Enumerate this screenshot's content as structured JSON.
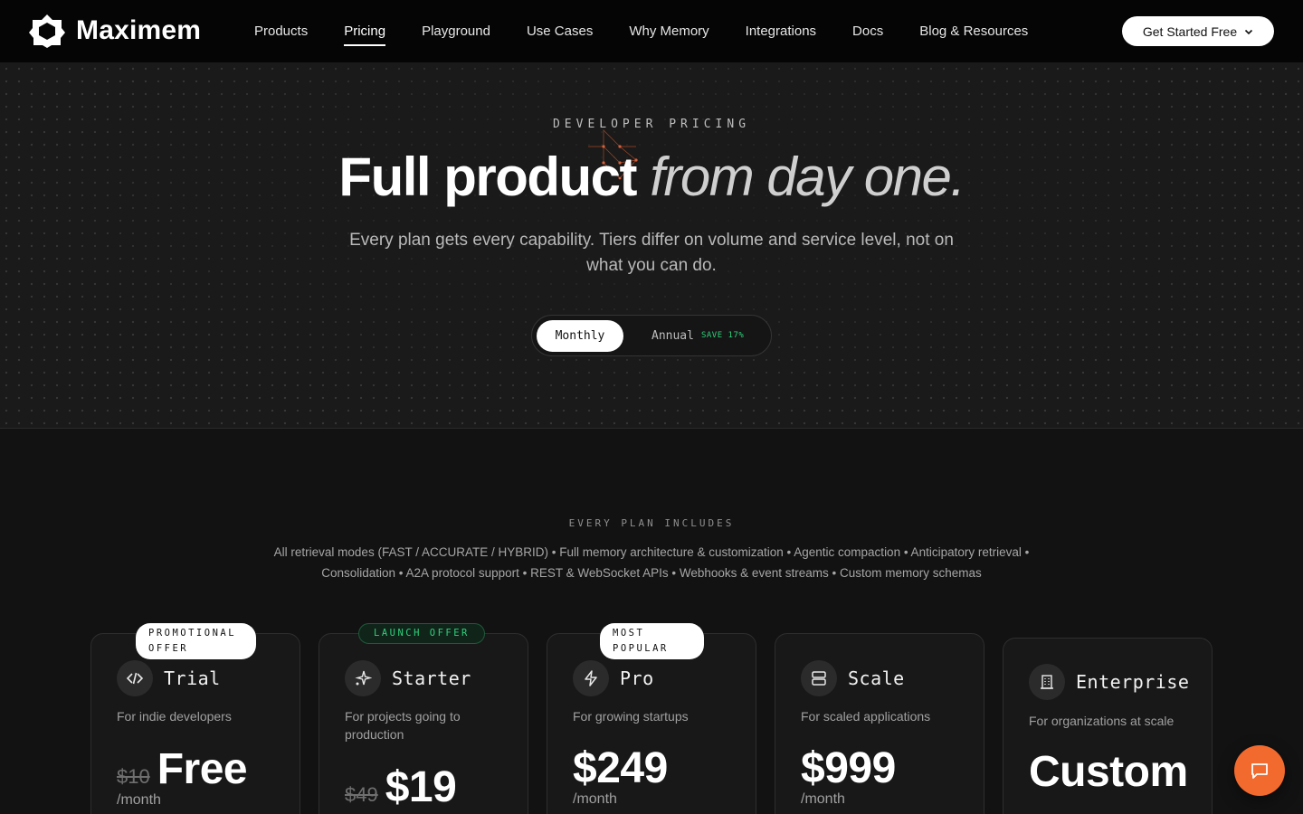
{
  "brand": {
    "name": "Maximem"
  },
  "nav": {
    "links": [
      {
        "label": "Products"
      },
      {
        "label": "Pricing"
      },
      {
        "label": "Playground"
      },
      {
        "label": "Use Cases"
      },
      {
        "label": "Why Memory"
      },
      {
        "label": "Integrations"
      },
      {
        "label": "Docs"
      },
      {
        "label": "Blog & Resources"
      }
    ],
    "active": "Pricing",
    "cta_label": "Get Started Free"
  },
  "hero": {
    "eyebrow": "DEVELOPER PRICING",
    "headline_bold": "Full product",
    "headline_italic": "from day one.",
    "subtext": "Every plan gets every capability. Tiers differ on volume and service level, not on what you can do.",
    "toggle": {
      "monthly": "Monthly",
      "annual": "Annual",
      "save": "SAVE 17%",
      "selected": "Monthly"
    }
  },
  "includes": {
    "title": "EVERY PLAN INCLUDES",
    "text": "All retrieval modes (FAST / ACCURATE / HYBRID) • Full memory architecture & customization • Agentic compaction • Anticipatory retrieval • Consolidation • A2A protocol support • REST & WebSocket APIs • Webhooks & event streams • Custom memory schemas"
  },
  "plans": [
    {
      "badge": "PROMOTIONAL OFFER",
      "badge_style": "white",
      "icon": "code-icon",
      "name": "Trial",
      "desc": "For indie developers",
      "old_price": "$10",
      "price": "Free",
      "per": "/month"
    },
    {
      "badge": "LAUNCH OFFER",
      "badge_style": "green",
      "icon": "sparkle-icon",
      "name": "Starter",
      "desc": "For projects going to production",
      "old_price": "$49",
      "price": "$19",
      "per": ""
    },
    {
      "badge": "MOST POPULAR",
      "badge_style": "white",
      "icon": "bolt-icon",
      "name": "Pro",
      "desc": "For growing startups",
      "old_price": "",
      "price": "$249",
      "per": "/month"
    },
    {
      "badge": "",
      "badge_style": "",
      "icon": "server-icon",
      "name": "Scale",
      "desc": "For scaled applications",
      "old_price": "",
      "price": "$999",
      "per": "/month"
    },
    {
      "badge": "",
      "badge_style": "",
      "icon": "building-icon",
      "name": "Enterprise",
      "desc": "For organizations at scale",
      "old_price": "",
      "price": "Custom",
      "per": ""
    }
  ],
  "chat": {
    "icon": "chat-bubble-icon"
  },
  "colors": {
    "accent": "#f26a2e",
    "save_green": "#2fd17a",
    "background": "#121212"
  }
}
